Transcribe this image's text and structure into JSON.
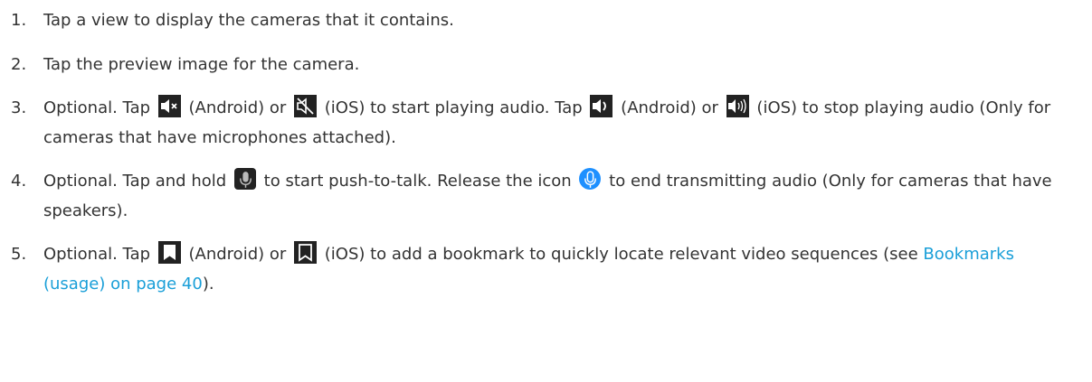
{
  "steps": [
    {
      "num": "1.",
      "text": "Tap a view to display the cameras that it contains."
    },
    {
      "num": "2.",
      "text": "Tap the preview image for the camera."
    },
    {
      "num": "3.",
      "parts": [
        "Optional. Tap",
        "(Android) or",
        "(iOS) to start playing audio. Tap",
        "(Android) or",
        "(iOS) to stop playing audio (Only for cameras that have microphones attached)."
      ],
      "icons": [
        "speaker-muted-android-icon",
        "speaker-muted-ios-icon",
        "speaker-on-android-icon",
        "speaker-on-ios-icon"
      ]
    },
    {
      "num": "4.",
      "parts": [
        "Optional. Tap and hold",
        "to start push-to-talk. Release the icon",
        "to end transmitting audio (Only for cameras that have speakers)."
      ],
      "icons": [
        "microphone-icon",
        "microphone-active-icon"
      ]
    },
    {
      "num": "5.",
      "parts": [
        "Optional. Tap",
        "(Android) or",
        "(iOS) to add a bookmark to quickly locate relevant video sequences (see",
        ")."
      ],
      "link": "Bookmarks (usage) on page 40",
      "icons": [
        "bookmark-android-icon",
        "bookmark-ios-icon"
      ]
    }
  ],
  "colors": {
    "text": "#333333",
    "link": "#1a9fd8",
    "icon_bg": "#222222",
    "mic_active": "#1e90ff"
  }
}
